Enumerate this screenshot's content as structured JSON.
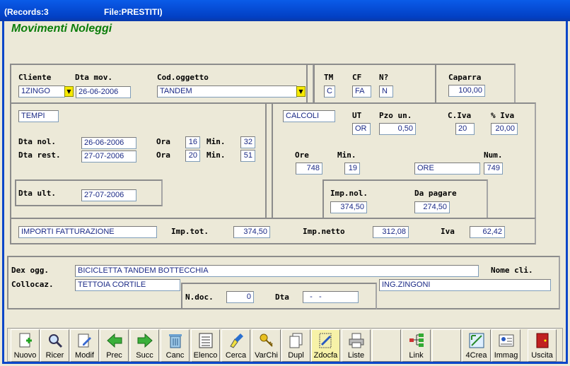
{
  "window": {
    "records": "(Records:3",
    "file": "File:PRESTITI)"
  },
  "form_title": "Movimenti Noleggi",
  "header": {
    "cliente_label": "Cliente",
    "cliente_value": "1ZINGO",
    "dta_mov_label": "Dta mov.",
    "dta_mov_value": "26-06-2006",
    "cod_oggetto_label": "Cod.oggetto",
    "cod_oggetto_value": "TANDEM",
    "tm_label": "TM",
    "tm_value": "C",
    "cf_label": "CF",
    "cf_value": "FA",
    "n_label": "N?",
    "n_value": "N",
    "caparra_label": "Caparra",
    "caparra_value": "100,00"
  },
  "tempi": {
    "section": "TEMPI",
    "dta_nol_label": "Dta nol.",
    "dta_nol_value": "26-06-2006",
    "dta_rest_label": "Dta rest.",
    "dta_rest_value": "27-07-2006",
    "ora_label": "Ora",
    "min_label": "Min.",
    "ora_nol": "16",
    "min_nol": "32",
    "ora_rest": "20",
    "min_rest": "51",
    "dta_ult_label": "Dta ult.",
    "dta_ult_value": "27-07-2006"
  },
  "calcoli": {
    "section": "CALCOLI",
    "ut_label": "UT",
    "ut_value": "OR",
    "pzo_label": "Pzo un.",
    "pzo_value": "0,50",
    "civa_label": "C.Iva",
    "civa_value": "20",
    "piva_label": "% Iva",
    "piva_value": "20,00",
    "ore_label": "Ore",
    "ore_value": "748",
    "min_label": "Min.",
    "min_value": "19",
    "unit_value": "ORE",
    "num_label": "Num.",
    "num_value": "749",
    "impnol_label": "Imp.nol.",
    "impnol_value": "374,50",
    "dapagare_label": "Da pagare",
    "dapagare_value": "274,50"
  },
  "fatturazione": {
    "section": "IMPORTI FATTURAZIONE",
    "imptot_label": "Imp.tot.",
    "imptot_value": "374,50",
    "impnetto_label": "Imp.netto",
    "impnetto_value": "312,08",
    "iva_label": "Iva",
    "iva_value": "62,42"
  },
  "details": {
    "dex_label": "Dex ogg.",
    "dex_value": "BICICLETTA TANDEM BOTTECCHIA",
    "nomecli_label": "Nome cli.",
    "nomecli_value": "ING.ZINGONI",
    "colloc_label": "Collocaz.",
    "colloc_value": "TETTOIA CORTILE",
    "ndoc_label": "N.doc.",
    "ndoc_value": "0",
    "dta_label": "Dta",
    "dta_value": "  -   -"
  },
  "toolbar": {
    "nuovo": "Nuovo",
    "ricer": "Ricer",
    "modif": "Modif",
    "prec": "Prec",
    "succ": "Succ",
    "canc": "Canc",
    "elenco": "Elenco",
    "cerca": "Cerca",
    "varchi": "VarChi",
    "dupl": "Dupl",
    "zdocfa": "Zdocfa",
    "liste": "Liste",
    "link": "Link",
    "crea4": "4Crea",
    "immag": "Immag",
    "uscita": "Uscita"
  },
  "colors": {
    "title_bar": "#0a5ce8",
    "heading": "#0b7d0b",
    "field_text": "#1b2a86",
    "dropdown": "#f6e900"
  }
}
